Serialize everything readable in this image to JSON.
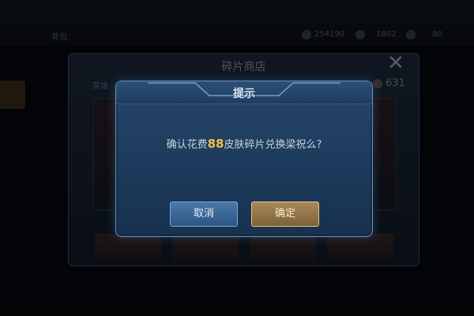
{
  "topbar": {
    "partial_label": "背包",
    "currency_1": "254190",
    "currency_2": "1802",
    "currency_3": "80"
  },
  "shop": {
    "title": "碎片商店",
    "close_icon": "close-icon",
    "tab_label": "英雄",
    "fragment_count": "631"
  },
  "dialog": {
    "title": "提示",
    "message_prefix": "确认花费",
    "cost": "88",
    "message_suffix": "皮肤碎片兑换梁祝么?",
    "cancel_label": "取消",
    "confirm_label": "确定"
  },
  "colors": {
    "dialog_bg": "#1d3b5c",
    "highlight": "#f2c24a",
    "confirm_button": "#9a7c4e",
    "cancel_button": "#3d6a98"
  }
}
